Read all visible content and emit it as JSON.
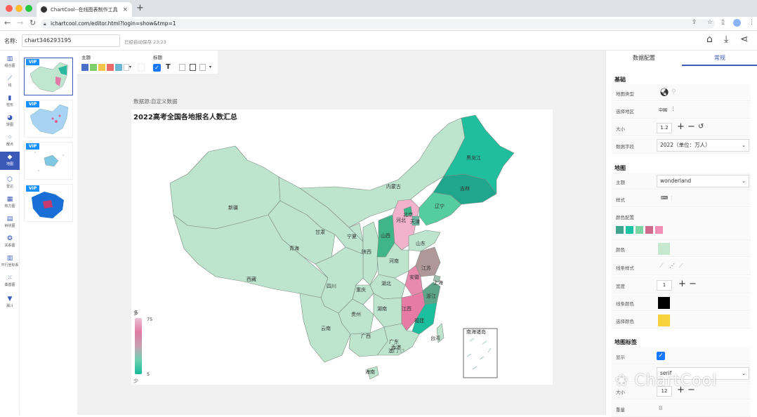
{
  "browser": {
    "tab_title": "ChartCool--在线图表制作工具",
    "url": "ichartcool.com/editor.html?login=show&tmp=1"
  },
  "header": {
    "name_label": "名称:",
    "chart_name": "chart346293195",
    "autosave": "已经自动保存 23:23"
  },
  "sidebar": {
    "items": [
      {
        "label": "组合图",
        "icon": "combo-chart-icon"
      },
      {
        "label": "线",
        "icon": "line-chart-icon"
      },
      {
        "label": "柱形",
        "icon": "bar-chart-icon"
      },
      {
        "label": "饼图",
        "icon": "pie-chart-icon"
      },
      {
        "label": "散点",
        "icon": "scatter-icon"
      },
      {
        "label": "地图",
        "icon": "map-icon"
      },
      {
        "label": "雷达",
        "icon": "radar-icon"
      },
      {
        "label": "热力图",
        "icon": "heatmap-icon"
      },
      {
        "label": "树状图",
        "icon": "tree-icon"
      },
      {
        "label": "关系图",
        "icon": "graph-icon"
      },
      {
        "label": "平行坐标系",
        "icon": "parallel-icon"
      },
      {
        "label": "桑基图",
        "icon": "sankey-icon"
      },
      {
        "label": "漏斗",
        "icon": "funnel-icon"
      }
    ],
    "thumb_badge": "VIP"
  },
  "toolbar": {
    "theme_label": "主题",
    "title_label": "标题",
    "theme_colors": [
      "#4a6fc8",
      "#7fcf6a",
      "#f3c64a",
      "#ea6a6a",
      "#6ab7d8"
    ]
  },
  "canvas": {
    "source": "数据源:自定义数据",
    "title": "2022高考全国各地报名人数汇总",
    "legend_hi": "多",
    "legend_lo": "少",
    "legend_max": "75",
    "legend_min": "5",
    "inset_label": "南海诸岛"
  },
  "map_labels": {
    "xinjiang": "新疆",
    "xizang": "西藏",
    "qinghai": "青海",
    "gansu": "甘肃",
    "ningxia": "宁夏",
    "neimenggu": "内蒙古",
    "heilongjiang": "黑龙江",
    "jilin": "吉林",
    "liaoning": "辽宁",
    "beijing": "北京",
    "tianjin": "天津",
    "hebei": "河北",
    "shanxi": "山西",
    "shaanxi": "陕西",
    "shandong": "山东",
    "henan": "河南",
    "jiangsu": "江苏",
    "shanghai": "上海",
    "anhui": "安徽",
    "zhejiang": "浙江",
    "hubei": "湖北",
    "sichuan": "四川",
    "chongqing": "重庆",
    "jiangxi": "江西",
    "hunan": "湖南",
    "fujian": "福建",
    "guizhou": "贵州",
    "yunnan": "云南",
    "guangxi": "广西",
    "guangdong": "广东",
    "taiwan": "台湾",
    "hainan": "海南",
    "xianggang": "香港",
    "aomen": "澳门"
  },
  "panel": {
    "tab_data": "数据配置",
    "tab_general": "常规",
    "section_basic": "基础",
    "map_type_label": "地图类型",
    "region_label": "选择地区",
    "region_value": "中国",
    "size_label": "大小",
    "size_value": "1.2",
    "field_label": "数据字段",
    "field_value": "2022（单位：万人）",
    "section_map": "地图",
    "theme_label": "主题",
    "theme_value": "wonderland",
    "style_label": "样式",
    "color_config_label": "颜色配置",
    "color_config": [
      "#3fa58f",
      "#1ec3a6",
      "#7bd6a4",
      "#d06a8c",
      "#f08fb3"
    ],
    "color_label": "颜色",
    "color_value": "#c6e8cf",
    "line_style_label": "线条样式",
    "width_label": "宽度",
    "width_value": "1",
    "line_color_label": "线条颜色",
    "line_color_value": "#000000",
    "select_color_label": "选择颜色",
    "select_color_value": "#f8d33c",
    "section_label": "地图标签",
    "show_label": "显示",
    "font_value": "serif",
    "label_size_label": "大小",
    "label_size_value": "12",
    "weight_label": "重量",
    "weight_value": "B"
  },
  "watermark": "ChartCool"
}
